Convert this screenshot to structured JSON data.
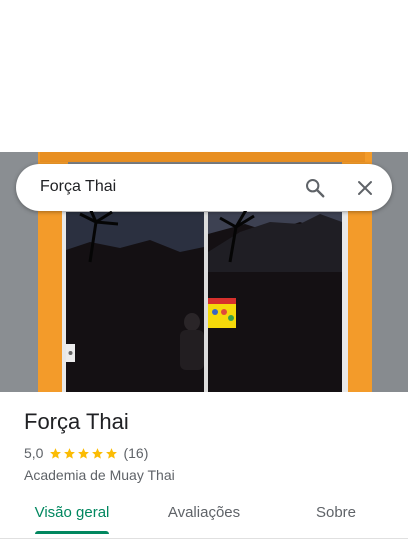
{
  "search": {
    "value": "Força Thai"
  },
  "place": {
    "name": "Força Thai",
    "rating": "5,0",
    "stars": 5,
    "review_count": "(16)",
    "category": "Academia de Muay Thai"
  },
  "tabs": [
    {
      "label": "Visão geral",
      "active": true
    },
    {
      "label": "Avaliações",
      "active": false
    },
    {
      "label": "Sobre",
      "active": false
    }
  ],
  "colors": {
    "accent": "#01875f",
    "star": "#fbbc04",
    "text": "#202124",
    "muted": "#5f6368"
  },
  "icons": {
    "search": "search-icon",
    "close": "close-icon",
    "star": "star-icon"
  }
}
